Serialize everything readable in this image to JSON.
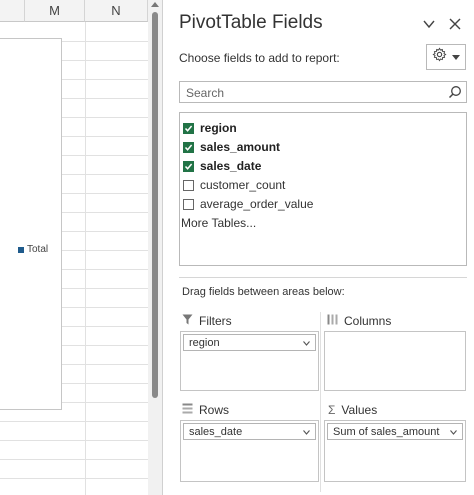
{
  "sheet": {
    "columns": [
      "M",
      "N"
    ],
    "legend_label": "Total",
    "legend_color": "#1f5b8c"
  },
  "pane": {
    "title": "PivotTable Fields",
    "choose_label": "Choose fields to add to report:",
    "search_placeholder": "Search",
    "fields": [
      {
        "label": "region",
        "checked": true
      },
      {
        "label": "sales_amount",
        "checked": true
      },
      {
        "label": "sales_date",
        "checked": true
      },
      {
        "label": "customer_count",
        "checked": false
      },
      {
        "label": "average_order_value",
        "checked": false
      }
    ],
    "more_tables": "More Tables...",
    "drag_label": "Drag fields between areas below:",
    "areas": {
      "filters": {
        "label": "Filters",
        "chip": "region"
      },
      "columns": {
        "label": "Columns"
      },
      "rows": {
        "label": "Rows",
        "chip": "sales_date"
      },
      "values": {
        "label": "Values",
        "chip": "Sum of sales_amount"
      }
    },
    "accent_color": "#217346"
  }
}
